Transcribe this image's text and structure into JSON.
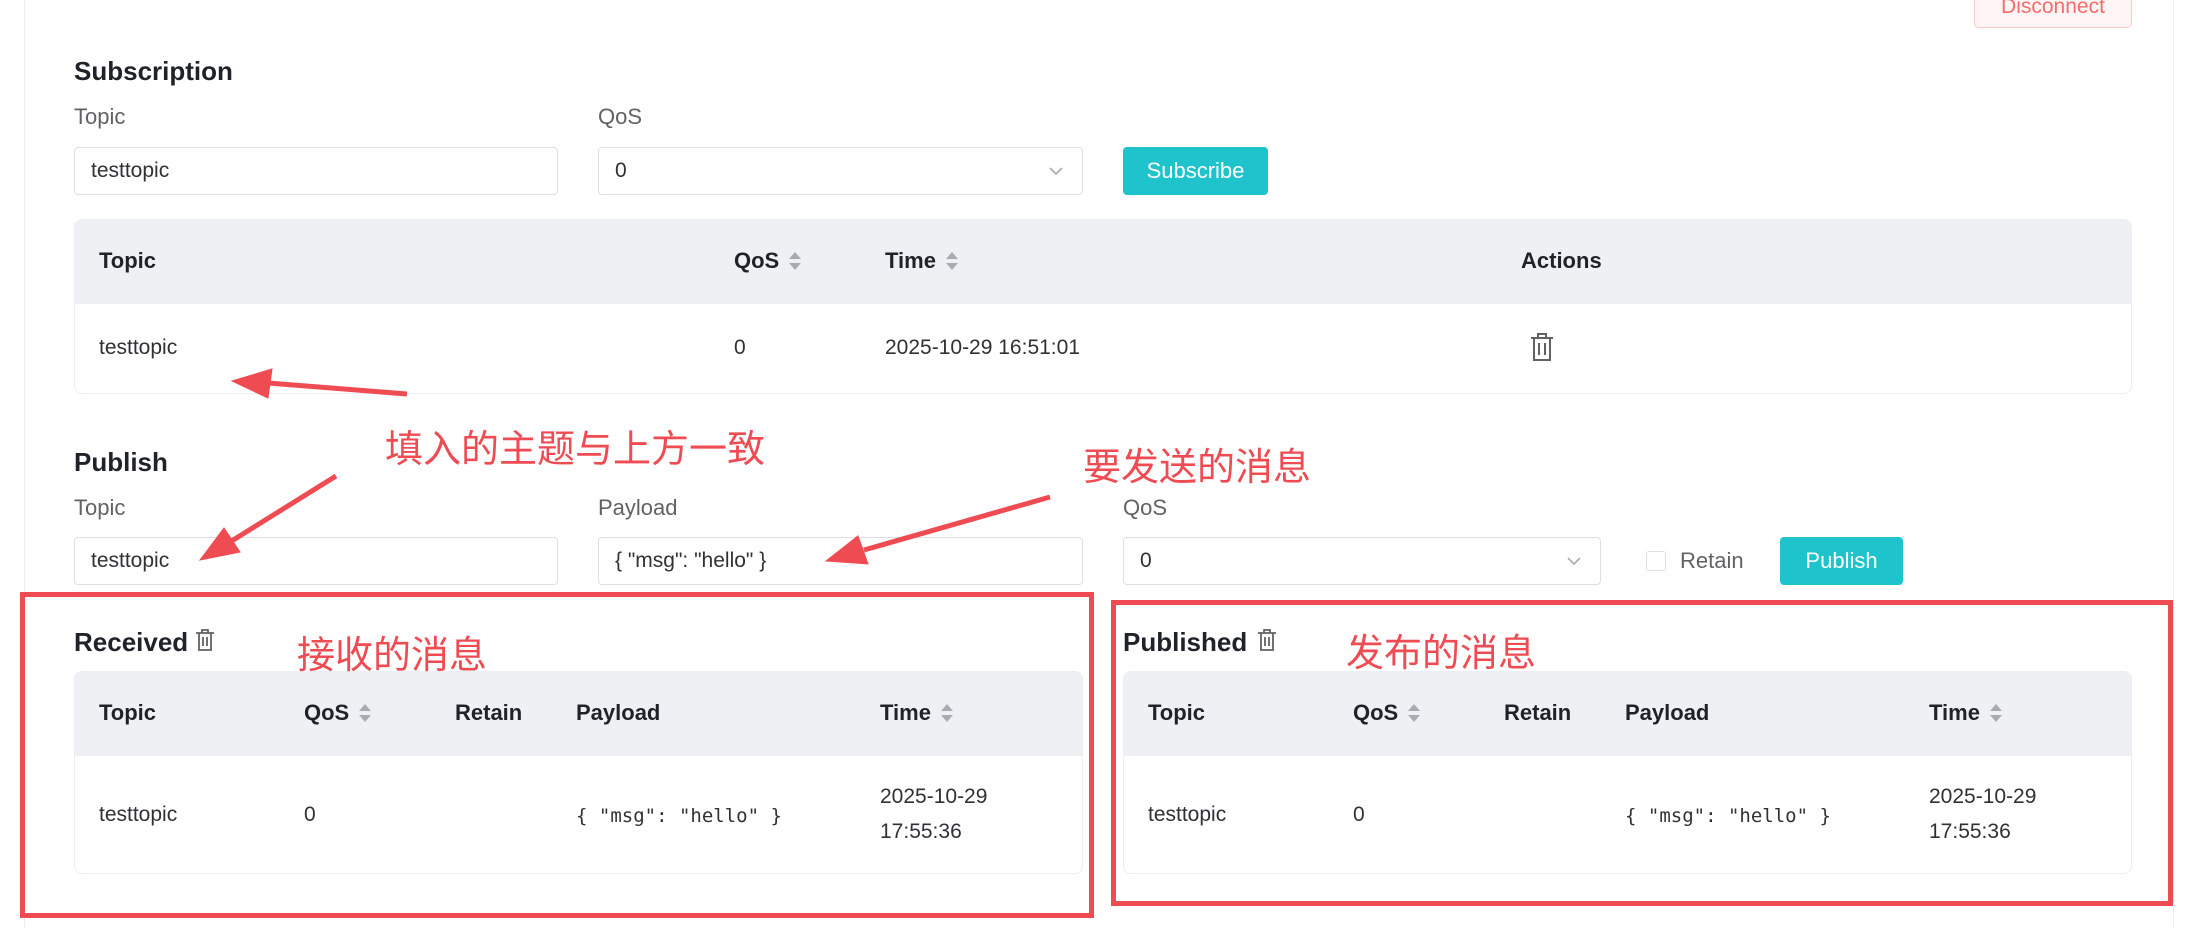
{
  "header": {
    "disconnect_label": "Disconnect"
  },
  "subscription": {
    "title": "Subscription",
    "topic_label": "Topic",
    "topic_value": "testtopic",
    "qos_label": "QoS",
    "qos_value": "0",
    "subscribe_label": "Subscribe",
    "table": {
      "columns": [
        "Topic",
        "QoS",
        "Time",
        "Actions"
      ],
      "rows": [
        {
          "topic": "testtopic",
          "qos": "0",
          "time": "2025-10-29 16:51:01"
        }
      ]
    }
  },
  "publish": {
    "title": "Publish",
    "topic_label": "Topic",
    "topic_value": "testtopic",
    "payload_label": "Payload",
    "payload_value": "{ \"msg\": \"hello\" }",
    "qos_label": "QoS",
    "qos_value": "0",
    "retain_label": "Retain",
    "publish_label": "Publish"
  },
  "received": {
    "title": "Received",
    "columns": [
      "Topic",
      "QoS",
      "Retain",
      "Payload",
      "Time"
    ],
    "rows": [
      {
        "topic": "testtopic",
        "qos": "0",
        "retain": "",
        "payload": "{ \"msg\": \"hello\" }",
        "time_date": "2025-10-29",
        "time_clock": "17:55:36"
      }
    ]
  },
  "published": {
    "title": "Published",
    "columns": [
      "Topic",
      "QoS",
      "Retain",
      "Payload",
      "Time"
    ],
    "rows": [
      {
        "topic": "testtopic",
        "qos": "0",
        "retain": "",
        "payload": "{ \"msg\": \"hello\" }",
        "time_date": "2025-10-29",
        "time_clock": "17:55:36"
      }
    ]
  },
  "annotations": {
    "topic_note": "填入的主题与上方一致",
    "payload_note": "要发送的消息",
    "received_note": "接收的消息",
    "published_note": "发布的消息"
  },
  "colors": {
    "accent": "#1fc3cc",
    "annotation": "#ef4b52",
    "danger": "#f56c6c",
    "table_header": "#eff0f4"
  },
  "icons": {
    "delete": "trash-icon",
    "dropdown": "chevron-down-icon",
    "sort": "sort-caret-icon"
  }
}
